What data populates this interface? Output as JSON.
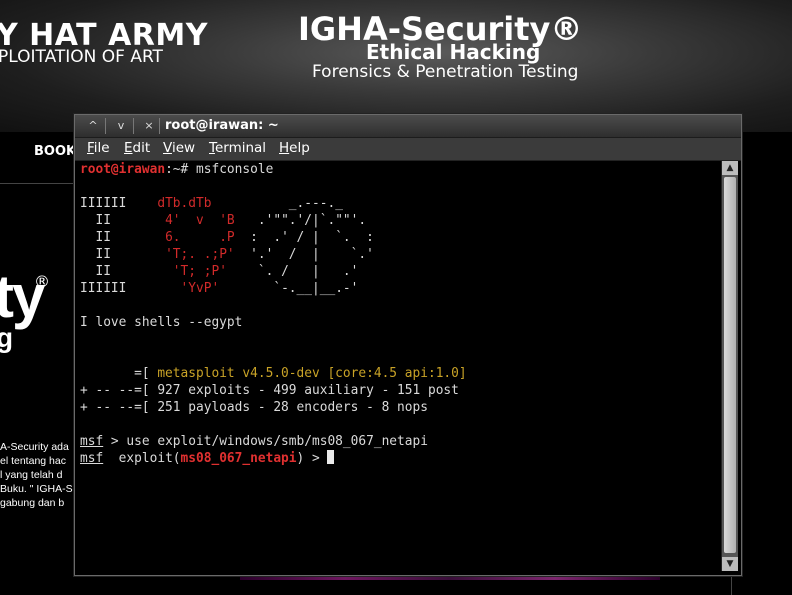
{
  "website": {
    "army_title": "Y HAT ARMY",
    "army_subtitle": "PLOITATION OF ART",
    "brand_title": "IGHA-Security®",
    "brand_subtitle": "Ethical Hacking",
    "brand_tagline": "Forensics & Penetration Testing",
    "nav_book": "BOOK",
    "side_logo": "ty",
    "side_reg": "®",
    "side_logo2": "g",
    "side_text": [
      "A-Security ada",
      "el tentang hac",
      "l yang telah d",
      "Buku. \" IGHA-S",
      "gabung dan b"
    ]
  },
  "terminal": {
    "window_title": "root@irawan: ~",
    "titlebar_buttons": [
      "^",
      "v",
      "×"
    ],
    "menu": [
      {
        "label": "File",
        "mnemonic": "F",
        "rest": "ile"
      },
      {
        "label": "Edit",
        "mnemonic": "E",
        "rest": "dit"
      },
      {
        "label": "View",
        "mnemonic": "V",
        "rest": "iew"
      },
      {
        "label": "Terminal",
        "mnemonic": "T",
        "rest": "erminal"
      },
      {
        "label": "Help",
        "mnemonic": "H",
        "rest": "elp"
      }
    ],
    "prompt_user": "root@irawan",
    "prompt_path": ":~# ",
    "command": "msfconsole",
    "banner_left": [
      "IIIIII",
      "  II  ",
      "  II  ",
      "  II  ",
      "  II  ",
      "IIIIII"
    ],
    "banner_mid": [
      "    dTb.dTb  ",
      "     4'  v  'B ",
      "     6.     .P ",
      "     'T;. .;P' ",
      "      'T; ;P'  ",
      "       'YvP'   "
    ],
    "banner_right": [
      "        _.---._",
      "  .'\"\".'/|`.\"\"'.",
      " :  .' / |  `.  :",
      " '.'  /  |    `.'",
      "  `. /   |   .'",
      "    `-.__|__.-'"
    ],
    "tagline": "I love shells --egypt",
    "version_prefix": "       =[ ",
    "version": "metasploit v4.5.0-dev [core:4.5 api:1.0]",
    "stats1": "+ -- --=[ 927 exploits - 499 auxiliary - 151 post",
    "stats2": "+ -- --=[ 251 payloads - 28 encoders - 8 nops",
    "msf_label": "msf",
    "cmd2": " > use exploit/windows/smb/ms08_067_netapi",
    "exploit_prefix": "  exploit(",
    "exploit_module": "ms08_067_netapi",
    "exploit_suffix": ") > "
  },
  "colors": {
    "prompt_red": "#d12a2a",
    "version_yellow": "#c9a327",
    "terminal_bg": "#000000"
  }
}
